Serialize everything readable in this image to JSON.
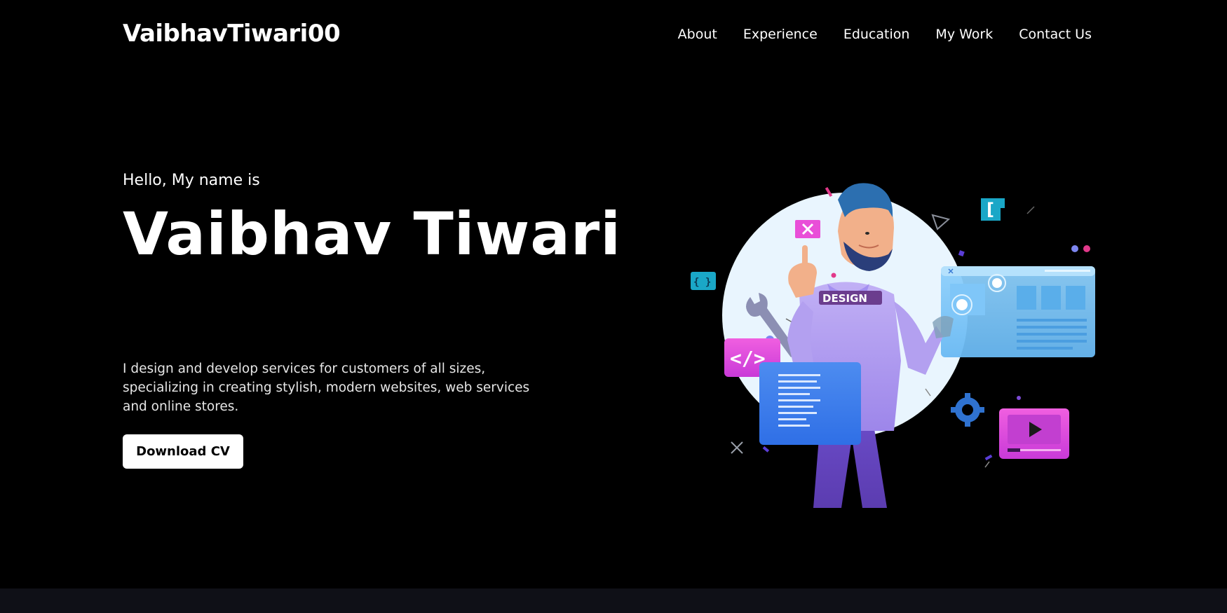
{
  "brand": {
    "logo": "VaibhavTiwari00"
  },
  "nav": {
    "links": [
      {
        "label": "About"
      },
      {
        "label": "Experience"
      },
      {
        "label": "Education"
      },
      {
        "label": "My Work"
      },
      {
        "label": "Contact Us"
      }
    ]
  },
  "hero": {
    "greeting": "Hello, My name is",
    "name": "Vaibhav Tiwari",
    "description": "I design and develop services for customers of all sizes, specializing in creating stylish, modern websites, web services and online stores.",
    "cta_label": "Download CV"
  },
  "illustration": {
    "shirt_text": "DESIGN",
    "code_symbol": "</>",
    "bracket_left": "[",
    "braces": "{ }"
  },
  "colors": {
    "background": "#000000",
    "text": "#ffffff",
    "button_bg": "#ffffff",
    "button_text": "#000000",
    "footer_strip": "#0f1017",
    "accent_purple": "#9b7ff0",
    "accent_pink": "#e94fd8",
    "accent_blue": "#4ba3f0",
    "accent_cyan": "#1aa7c7"
  }
}
